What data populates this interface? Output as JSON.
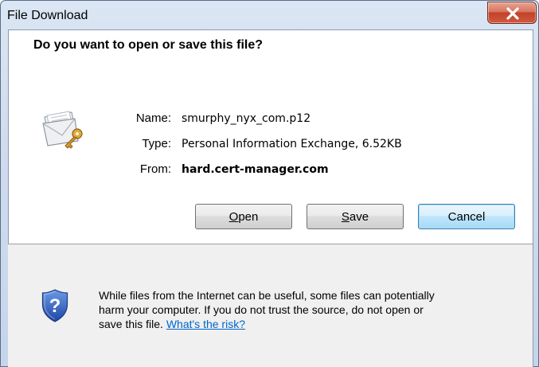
{
  "window": {
    "title": "File Download"
  },
  "dialog": {
    "question": "Do you want to open or save this file?",
    "file": {
      "name_label": "Name:",
      "name_value": "smurphy_nyx_com.p12",
      "type_label": "Type:",
      "type_value": "Personal Information Exchange, 6.52KB",
      "from_label": "From:",
      "from_value": "hard.cert-manager.com"
    },
    "buttons": {
      "open_mnemonic": "O",
      "open_rest": "pen",
      "save_mnemonic": "S",
      "save_rest": "ave",
      "cancel_label": "Cancel"
    },
    "warning": {
      "line1": "While files from the Internet can be useful, some files can potentially",
      "line2": "harm your computer. If you do not trust the source, do not open or",
      "line3": "save this file.",
      "link": "What's the risk?"
    }
  },
  "icons": {
    "close": "close-icon",
    "file": "certificate-file-icon",
    "security": "security-shield-icon"
  },
  "colors": {
    "link": "#0066cc",
    "close_button": "#c2422a",
    "default_button_border": "#3c7fb1",
    "shield_blue": "#2b58b8"
  }
}
